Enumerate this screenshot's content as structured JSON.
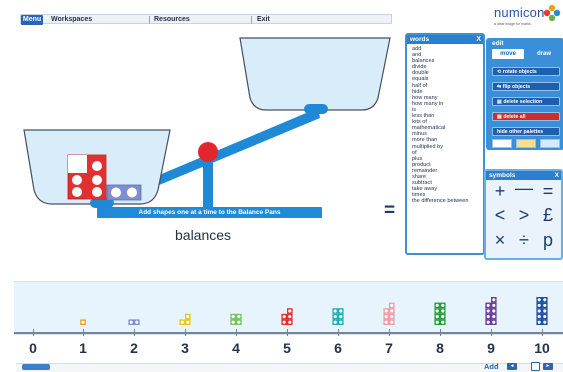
{
  "menu": {
    "menu_label": "Menu",
    "workspaces_label": "Workspaces",
    "resources_label": "Resources",
    "exit_label": "Exit"
  },
  "logo": {
    "text": "numicon",
    "tagline": "a clear image for maths"
  },
  "words_panel": {
    "title": "words",
    "close": "X",
    "items": [
      "add",
      "and",
      "balances",
      "divide",
      "double",
      "equals",
      "half of",
      "hide",
      "how many",
      "how many in",
      "is",
      "less than",
      "lots of",
      "mathematical",
      "minus",
      "more than",
      "multiplied by",
      "of",
      "plus",
      "product",
      "remainder",
      "share",
      "subtract",
      "take away",
      "times",
      "the difference between"
    ]
  },
  "edit_panel": {
    "title": "edit",
    "tab_move": "move",
    "tab_draw": "draw",
    "buttons": [
      "rotate objects",
      "flip objects",
      "delete selection",
      "delete all",
      "hide other palettes"
    ],
    "colors": {
      "accent": "#3b8fd8",
      "delete_all": "#c9302c",
      "swatch_1": "#ffffff",
      "swatch_2": "#f8e08a",
      "swatch_3": "#d6e9fa"
    }
  },
  "symbols_panel": {
    "title": "symbols",
    "close": "X",
    "symbols": [
      "+",
      "—",
      "=",
      "<",
      ">",
      "£",
      "×",
      "÷",
      "p"
    ]
  },
  "workspace": {
    "instruction": "Add shapes one at a time to the Balance Pans",
    "caption": "balances",
    "equals_sign": "="
  },
  "number_line": {
    "numbers": [
      "0",
      "1",
      "2",
      "3",
      "4",
      "5",
      "6",
      "7",
      "8",
      "9",
      "10"
    ],
    "shape_colors": [
      "#f0a020",
      "#7d8fcc",
      "#e8c81e",
      "#7bbf5e",
      "#e03030",
      "#1fb0b8",
      "#f19aa8",
      "#28a040",
      "#6a3d9a",
      "#1e4fa0"
    ]
  },
  "footer": {
    "add_label": "Add",
    "prev": "◄",
    "next": "►"
  },
  "colors": {
    "pivot": "#e3262d",
    "beam": "#1e8ad6",
    "pan_fill": "#d9ecfa",
    "pan_stroke": "#44505f"
  }
}
